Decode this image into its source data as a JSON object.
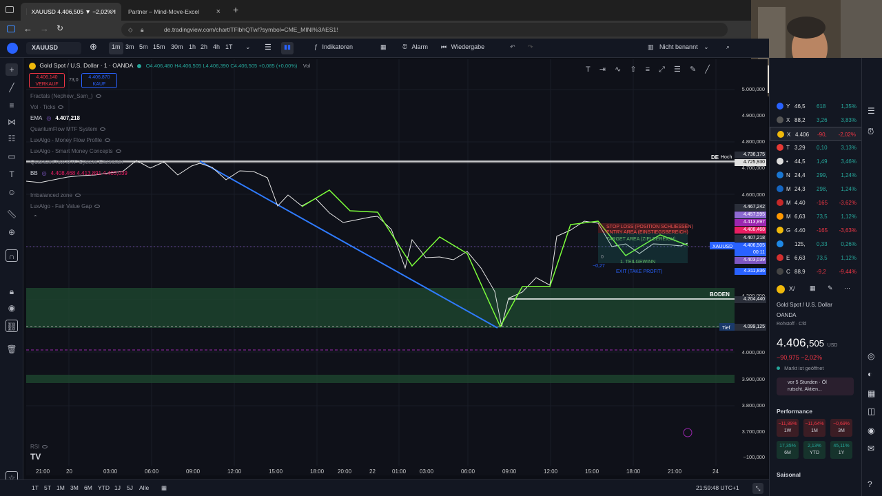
{
  "browser": {
    "tabs": [
      {
        "label": "XAUUSD 4.406,505 ▼ −2,02% I"
      },
      {
        "label": "Partner – Mind-Move-Excel"
      }
    ],
    "url": "de.tradingview.com/chart/TFlbhQTw/?symbol=CME_MINI%3AES1!"
  },
  "toolbar": {
    "symbol": "XAUUSD",
    "intervals": [
      "1m",
      "3m",
      "5m",
      "15m",
      "30m",
      "1h",
      "2h",
      "4h",
      "1T"
    ],
    "indicators_label": "Indikatoren",
    "alarm_label": "Alarm",
    "replay_label": "Wiedergabe",
    "layout_name": "Nicht benannt"
  },
  "chart_header": {
    "title": "Gold Spot / U.S. Dollar · 1 · OANDA",
    "ohlc": {
      "open": "O4.406,480",
      "high": "H4.406,505",
      "low": "L4.406,390",
      "close": "C4.406,505",
      "change": "+0,085 (+0,00%)",
      "vol": "Vol"
    },
    "sell_price": "4.406,140",
    "sell_label": "VERKAUF",
    "spread": "73,0",
    "buy_price": "4.406,870",
    "buy_label": "KAUF"
  },
  "indicators": [
    {
      "name": "Fractals (Nephew_Sam_)",
      "value": ""
    },
    {
      "name": "Vol · Ticks",
      "value": ""
    },
    {
      "name": "EMA",
      "value": "4.407,218"
    },
    {
      "name": "QuantumFlow MTF System",
      "value": ""
    },
    {
      "name": "LuxAlgo - Money Flow Profile",
      "value": ""
    },
    {
      "name": "LuxAlgo - Smart Money Concepts",
      "value": ""
    },
    {
      "name": "QuantumFlow MTF System Extension",
      "value": ""
    },
    {
      "name": "BB",
      "value": "4.408,468  4.413,891  4.403,039"
    },
    {
      "name": "Imbalanced zone",
      "value": ""
    },
    {
      "name": "LuxAlgo - Fair Value Gap",
      "value": ""
    }
  ],
  "rsi_label": "RSI",
  "price_axis": {
    "ticks": [
      "5.000,000",
      "4.900,000",
      "4.800,000",
      "4.700,000",
      "4.600,000",
      "4.500,000",
      "4.400,000",
      "4.300,000",
      "4.200,000",
      "4.100,000",
      "4.000,000",
      "3.900,000",
      "3.800,000",
      "3.700,000",
      "−100,000"
    ],
    "labels": [
      {
        "text": "4.736,175",
        "color": "#2a2e39"
      },
      {
        "text": "4.725,930",
        "color": "#e0e0e0"
      },
      {
        "text": "4.467,242",
        "color": "#2a2e39"
      },
      {
        "text": "4.457,595",
        "color": "#8e6bd3"
      },
      {
        "text": "4.413,897",
        "color": "#9c27b0"
      },
      {
        "text": "4.408,468",
        "color": "#e91e63"
      },
      {
        "text": "4.407,218",
        "color": "#2a2e39"
      },
      {
        "text": "4.406,505",
        "color": "#2962ff"
      },
      {
        "text": "00:11",
        "color": "#2962ff"
      },
      {
        "text": "4.403,039",
        "color": "#7e57c2"
      },
      {
        "text": "4.311,836",
        "color": "#2962ff"
      },
      {
        "text": "4.204,440",
        "color": "#2a2e39"
      },
      {
        "text": "4.099,125",
        "color": "#2a2e39"
      }
    ]
  },
  "annotations": {
    "hoch_label": "Hoch",
    "de_label": "DE",
    "boden_label": "BODEN",
    "tief_label": "Tief",
    "xauusd_tag": "XAUUSD",
    "stop_loss": "STOP LOSS (POSITION SCHLIESSEN)",
    "entry_area": "ENTRY AREA (EINSTIEGSBEREICH)",
    "target_area": "TARGET AREA (ZIELBEREICH)",
    "first_target": "1. TEILGEWINN",
    "exit": "EXIT (TAKE PROFIT)",
    "zero": "0",
    "neg": "−0,27"
  },
  "time_axis": [
    "21:00",
    "20",
    "03:00",
    "06:00",
    "09:00",
    "12:00",
    "15:00",
    "18:00",
    "20:00",
    "22",
    "01:00",
    "03:00",
    "06:00",
    "09:00",
    "12:00",
    "15:00",
    "18:00",
    "21:00",
    "24"
  ],
  "bottom": {
    "ranges": [
      "1T",
      "5T",
      "1M",
      "3M",
      "6M",
      "YTD",
      "1J",
      "5J",
      "Alle"
    ],
    "clock": "21:59:48 UTC+1"
  },
  "watchlist": [
    {
      "sym": "Y",
      "last": "46,5",
      "chg": "618",
      "pct": "1,35%",
      "dir": "pos",
      "color": "#2962ff"
    },
    {
      "sym": "X",
      "last": "88,2",
      "chg": "3,26",
      "pct": "3,83%",
      "dir": "pos",
      "color": "#555"
    },
    {
      "sym": "X",
      "last": "4.406",
      "chg": "-90,",
      "pct": "-2,02%",
      "dir": "neg",
      "color": "#f0b90b"
    },
    {
      "sym": "T",
      "last": "3,29",
      "chg": "0,10",
      "pct": "3,13%",
      "dir": "pos",
      "color": "#e53935"
    },
    {
      "sym": "•",
      "last": "44,5",
      "chg": "1,49",
      "pct": "3,46%",
      "dir": "pos",
      "color": "#ddd"
    },
    {
      "sym": "N",
      "last": "24,4",
      "chg": "299,",
      "pct": "1,24%",
      "dir": "pos",
      "color": "#1976d2"
    },
    {
      "sym": "M",
      "last": "24,3",
      "chg": "298,",
      "pct": "1,24%",
      "dir": "pos",
      "color": "#1565c0"
    },
    {
      "sym": "M",
      "last": "4.40",
      "chg": "-165",
      "pct": "-3,62%",
      "dir": "neg",
      "color": "#c62828"
    },
    {
      "sym": "M",
      "last": "6,63",
      "chg": "73,5",
      "pct": "1,12%",
      "dir": "pos",
      "color": "#ff9800"
    },
    {
      "sym": "G",
      "last": "4.40",
      "chg": "-165",
      "pct": "-3,63%",
      "dir": "neg",
      "color": "#f0b90b"
    },
    {
      "sym": "",
      "last": "125,",
      "chg": "0,33",
      "pct": "0,26%",
      "dir": "pos",
      "color": "#1e88e5"
    },
    {
      "sym": "E",
      "last": "6,63",
      "chg": "73,5",
      "pct": "1,12%",
      "dir": "pos",
      "color": "#d32f2f"
    },
    {
      "sym": "C",
      "last": "88,9",
      "chg": "-9,2",
      "pct": "-9,44%",
      "dir": "neg",
      "color": "#444"
    }
  ],
  "details": {
    "symbol_short": "X/",
    "name": "Gold Spot / U.S. Dollar",
    "exchange": "OANDA",
    "type": "Rohstoff · Cfd",
    "price_main": "4.406,",
    "price_frac": "505",
    "currency": "USD",
    "change": "−90,975 −2,02%",
    "market_status": "Markt ist geöffnet",
    "news": "vor 5 Stunden · Öl rutscht, Aktien...",
    "performance_label": "Performance",
    "performance": [
      {
        "value": "−11,89%",
        "period": "1W",
        "dir": "neg"
      },
      {
        "value": "−11,64%",
        "period": "1M",
        "dir": "neg"
      },
      {
        "value": "−0,69%",
        "period": "3M",
        "dir": "neg"
      },
      {
        "value": "17,35%",
        "period": "6M",
        "dir": "pos"
      },
      {
        "value": "2,13%",
        "period": "YTD",
        "dir": "pos"
      },
      {
        "value": "45,11%",
        "period": "1Y",
        "dir": "pos"
      }
    ],
    "seasonal_label": "Saisonal"
  }
}
